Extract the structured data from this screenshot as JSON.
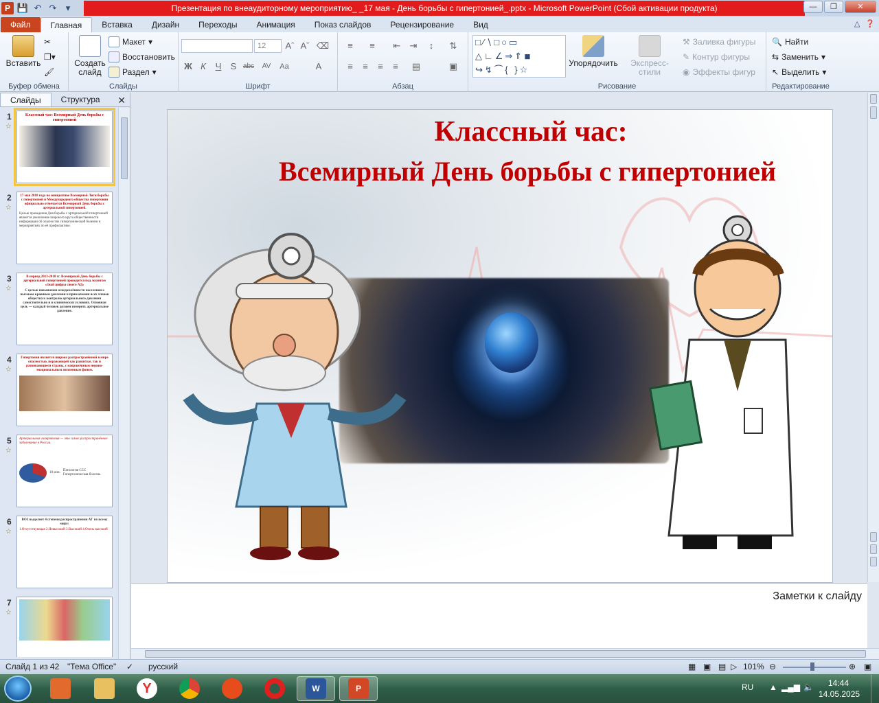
{
  "window": {
    "title": "Презентация по внеаудиторному мероприятию_ _17 мая - День борьбы с гипертонией_.pptx - Microsoft PowerPoint (Сбой активации продукта)",
    "logo": "P"
  },
  "tabs": [
    {
      "label": "Файл"
    },
    {
      "label": "Главная"
    },
    {
      "label": "Вставка"
    },
    {
      "label": "Дизайн"
    },
    {
      "label": "Переходы"
    },
    {
      "label": "Анимация"
    },
    {
      "label": "Показ слайдов"
    },
    {
      "label": "Рецензирование"
    },
    {
      "label": "Вид"
    }
  ],
  "ribbon": {
    "clipboard": {
      "label": "Буфер обмена",
      "paste": "Вставить"
    },
    "slides": {
      "label": "Слайды",
      "new_slide": "Создать слайд",
      "layout": "Макет",
      "reset": "Восстановить",
      "section": "Раздел"
    },
    "font": {
      "label": "Шрифт",
      "size": "12"
    },
    "paragraph": {
      "label": "Абзац"
    },
    "drawing": {
      "label": "Рисование",
      "arrange": "Упорядочить",
      "quick_styles": "Экспресс-стили",
      "fill": "Заливка фигуры",
      "outline": "Контур фигуры",
      "effects": "Эффекты фигур"
    },
    "editing": {
      "label": "Редактирование",
      "find": "Найти",
      "replace": "Заменить",
      "select": "Выделить"
    }
  },
  "left_panel": {
    "tabs": [
      "Слайды",
      "Структура"
    ],
    "thumbs": [
      {
        "num": "1",
        "title": "Классный час: Всемирный День борьбы с гипертонией"
      },
      {
        "num": "2",
        "title": "17 мая 2018 года по инициативе Всемирной Лиги борьбы с гипертонией и Международного общества гипертонии официально отмечается Всемирный День борьбы с артериальной гипертонией.",
        "body": "Целью проведения Дня борьбы с артериальной гипертонией является увеличение широкого круга общественности информации об опасностях гипертонической болезни и мероприятиях по её профилактике."
      },
      {
        "num": "3",
        "title": "В период 2013-2018 гг. Всемирный День борьбы с артериальной гипертонией проводится под лозунгом «Знай цифры своего АД»",
        "body": "С целью повышения осведомлённости населения о высоком кровяном давлении и привлечения всех членов общества к контролю артериального давления самостоятельно и в клинических условиях. Основная цель — каждый человек должен измерять артериальное давление."
      },
      {
        "num": "4",
        "title": "Гипертония является широко распространённой в мире опасностью, поражающей как развитые, так и развивающиеся страны, с напряжённым нервно-эмоциональным жизненным фоном."
      },
      {
        "num": "5",
        "title": "Артериальная гипертензия — это самое распространённое заболевание в России.",
        "legend1": "Патология ССС",
        "legend2": "Гипертоническая болезнь",
        "pie": "10 млн."
      },
      {
        "num": "6",
        "title": "ВОЗ выделяет 4 степени распространения АГ по всему миру:",
        "body": "1.Отсутствующая 2.Невысокий 3.Высокий 4.Очень высокий"
      },
      {
        "num": "7",
        "title": ""
      }
    ]
  },
  "slide": {
    "title_line1": "Классный час:",
    "title_line2": "Всемирный День борьбы с гипертонией"
  },
  "notes": {
    "placeholder": "Заметки к слайду"
  },
  "status": {
    "slide_of": "Слайд 1 из 42",
    "theme": "\"Тема Office\"",
    "language": "русский",
    "zoom": "101%"
  },
  "tray": {
    "lang": "RU",
    "time": "14:44",
    "date": "14.05.2025"
  }
}
